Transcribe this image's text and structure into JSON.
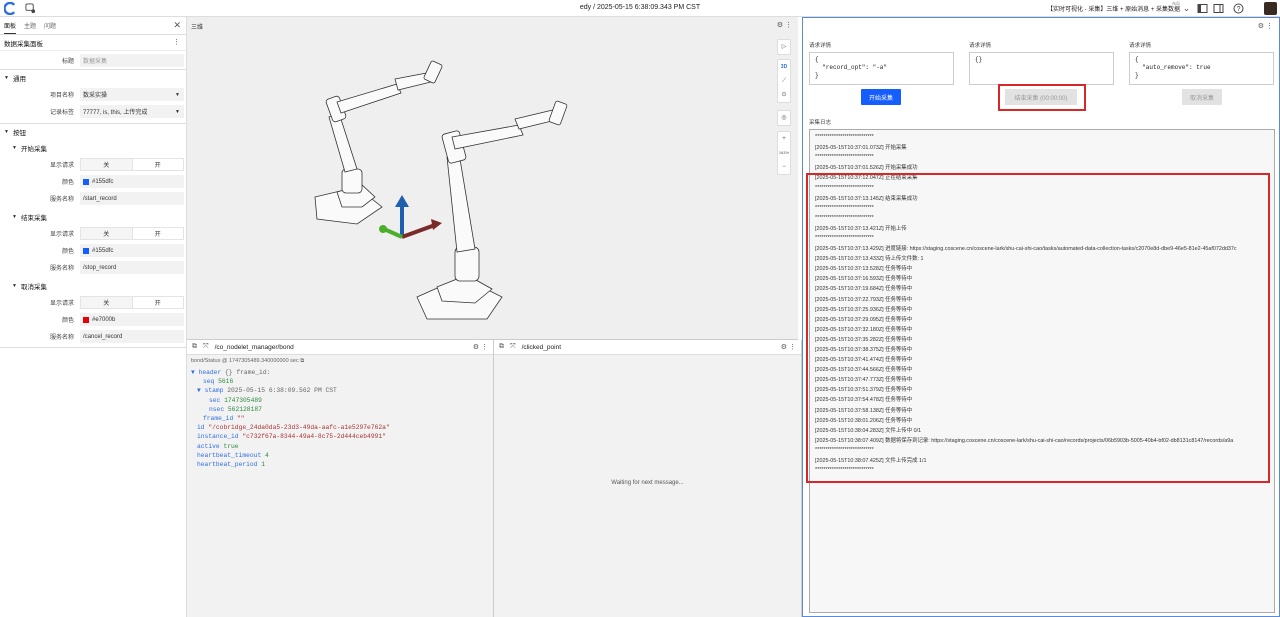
{
  "topbar": {
    "title": "edy / 2025-05-15 6:38:09.343 PM CST",
    "layout_small": "布局",
    "layout_name": "【实时可视化 - 采集】三维 + 原始消息 + 采集数据"
  },
  "left": {
    "tabs": [
      "面板",
      "主题",
      "问题"
    ],
    "panel_title": "数据采集面板",
    "title_label": "标题",
    "title_placeholder": "数据采集",
    "general": "通用",
    "project_label": "项目名称",
    "project_value": "数采实操",
    "record_tag_label": "记录标签",
    "record_tag_value": "77777, is, this, 上传完成",
    "buttons": "按钮",
    "groups": [
      {
        "name": "开始采集",
        "show_label": "显示请求",
        "off": "关",
        "on": "开",
        "color_label": "颜色",
        "color": "#155dfc",
        "service_label": "服务名称",
        "service": "/start_record"
      },
      {
        "name": "结束采集",
        "show_label": "显示请求",
        "off": "关",
        "on": "开",
        "color_label": "颜色",
        "color": "#155dfc",
        "service_label": "服务名称",
        "service": "/stop_record"
      },
      {
        "name": "取消采集",
        "show_label": "显示请求",
        "off": "关",
        "on": "开",
        "color_label": "颜色",
        "color": "#e7000b",
        "service_label": "服务名称",
        "service": "/cancel_record"
      }
    ]
  },
  "view3d": {
    "title": "三维",
    "tools": [
      "3D",
      "181%"
    ]
  },
  "bond_panel": {
    "topic": "/co_nodelet_manager/bond",
    "meta": "bond/Status @ 1747305489.340000000 sec",
    "lines": [
      {
        "k": "header",
        "v": "{} frame_id:"
      },
      {
        "k": "seq",
        "v": "5616"
      },
      {
        "k": "stamp",
        "v": "2025-05-15 6:38:09.562 PM CST"
      },
      {
        "k": "sec",
        "v": "1747305489"
      },
      {
        "k": "nsec",
        "v": "562128187"
      },
      {
        "k": "frame_id",
        "v": "\"\""
      },
      {
        "k": "id",
        "v": "\"/cobridge_24da0da5-23d3-49da-aafc-a1e5297e762a\""
      },
      {
        "k": "instance_id",
        "v": "\"c732f67a-8344-49a4-8c75-2d444ceb4991\""
      },
      {
        "k": "active",
        "v": "true"
      },
      {
        "k": "heartbeat_timeout",
        "v": "4"
      },
      {
        "k": "heartbeat_period",
        "v": "1"
      }
    ]
  },
  "clicked_panel": {
    "topic": "/clicked_point",
    "waiting": "Waiting for next message..."
  },
  "right": {
    "req1_label": "请求详情",
    "req1": "{\n  \"record_opt\": \"-a\"\n}",
    "req2_label": "请求详情",
    "req2": "{}",
    "req3_label": "请求详情",
    "req3": "{\n  \"auto_remove\": true\n}",
    "start_btn": "开始采集",
    "stop_btn": "结束采集 (00:00:00)",
    "cancel_btn": "取消采集",
    "log_label": "采集日志",
    "log": [
      "****************************",
      "[2025-05-15T10:37:01.073Z] 开始采集",
      "****************************",
      "[2025-05-15T10:37:01.526Z] 开始采集成功",
      "[2025-05-15T10:37:12.047Z] 正在结束采集",
      "****************************",
      "[2025-05-15T10:37:13.145Z] 结束采集成功",
      "****************************",
      "****************************",
      "[2025-05-15T10:37:13.421Z] 开始上传",
      "****************************",
      "[2025-05-15T10:37:13.429Z] 进度链接: https://staging.coscene.cn/coscene-lark/shu-cai-shi-cao/tasks/automated-data-collection-tasks/c2070e8d-dbe9-46e5-81e2-45af072dd37c",
      "[2025-05-15T10:37:13.433Z] 待上传文件数: 1",
      "[2025-05-15T10:37:13.528Z] 任务等待中",
      "[2025-05-15T10:37:16.593Z] 任务等待中",
      "[2025-05-15T10:37:19.684Z] 任务等待中",
      "[2025-05-15T10:37:22.793Z] 任务等待中",
      "[2025-05-15T10:37:25.936Z] 任务等待中",
      "[2025-05-15T10:37:29.095Z] 任务等待中",
      "[2025-05-15T10:37:32.180Z] 任务等待中",
      "[2025-05-15T10:37:35.282Z] 任务等待中",
      "[2025-05-15T10:37:38.375Z] 任务等待中",
      "[2025-05-15T10:37:41.474Z] 任务等待中",
      "[2025-05-15T10:37:44.566Z] 任务等待中",
      "[2025-05-15T10:37:47.773Z] 任务等待中",
      "[2025-05-15T10:37:51.379Z] 任务等待中",
      "[2025-05-15T10:37:54.478Z] 任务等待中",
      "[2025-05-15T10:37:58.138Z] 任务等待中",
      "[2025-05-15T10:38:01.206Z] 任务等待中",
      "[2025-05-15T10:38:04.283Z] 文件上传中 0/1",
      "[2025-05-15T10:38:07.409Z] 数据将保存到记录: https://staging.coscene.cn/coscene-lark/shu-cai-shi-cao/records/projects/06b5903b-5005-40b4-bf02-db8131c8147/records/a9a",
      "****************************",
      "[2025-05-15T10:38:07.425Z] 文件上传完成 1/1",
      "****************************"
    ]
  }
}
